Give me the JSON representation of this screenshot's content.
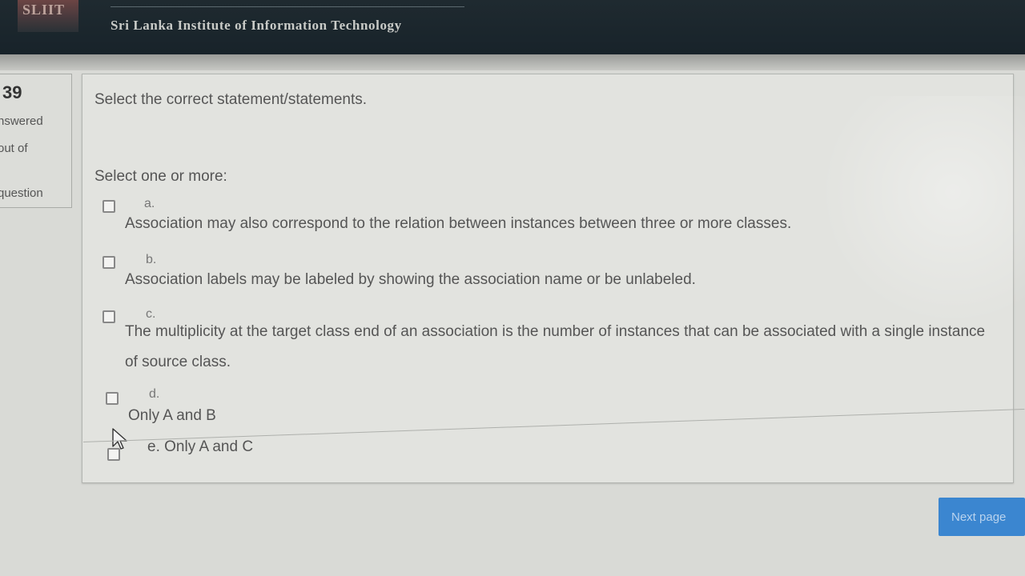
{
  "header": {
    "logo_text": "SLIIT",
    "institution": "Sri Lanka Institute of Information Technology"
  },
  "question_info": {
    "number": "39",
    "status": "nswered",
    "marks": "out of",
    "flag": "question"
  },
  "question": {
    "text": "Select the correct statement/statements.",
    "prompt": "Select one or more:",
    "options": [
      {
        "letter": "a.",
        "text": "Association may also correspond to the relation between instances between three or more classes."
      },
      {
        "letter": "b.",
        "text": "Association labels may be labeled by showing the association name or be unlabeled."
      },
      {
        "letter": "c.",
        "text": "The multiplicity at the target class end of an association is the number of instances that can be associated with a single instance of source class."
      },
      {
        "letter": "d.",
        "text": "Only A and B"
      },
      {
        "letter": "e.",
        "text": "Only A and C"
      }
    ]
  },
  "navigation": {
    "next_label": "Next page"
  }
}
